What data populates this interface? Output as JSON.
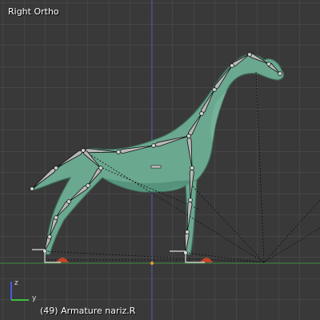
{
  "viewport": {
    "view_name": "Right Ortho",
    "frame": "(49)",
    "object_name": "Armature nariz.R"
  },
  "axes_gizmo": {
    "y_label": "y",
    "z_label": "z"
  },
  "colors": {
    "background": "#393939",
    "grid_minor": "#444444",
    "grid_major": "#4e4e4e",
    "horizon_axis": "#3f8f3f",
    "vertical_axis": "#5555aa",
    "mesh_fill": "#6aa88f",
    "mesh_shadow": "#3f6e5c",
    "bone_fill": "#b8b8b8",
    "bone_outline": "#101010",
    "foot_marker": "#c0442a",
    "origin_dot": "#e8a030"
  }
}
